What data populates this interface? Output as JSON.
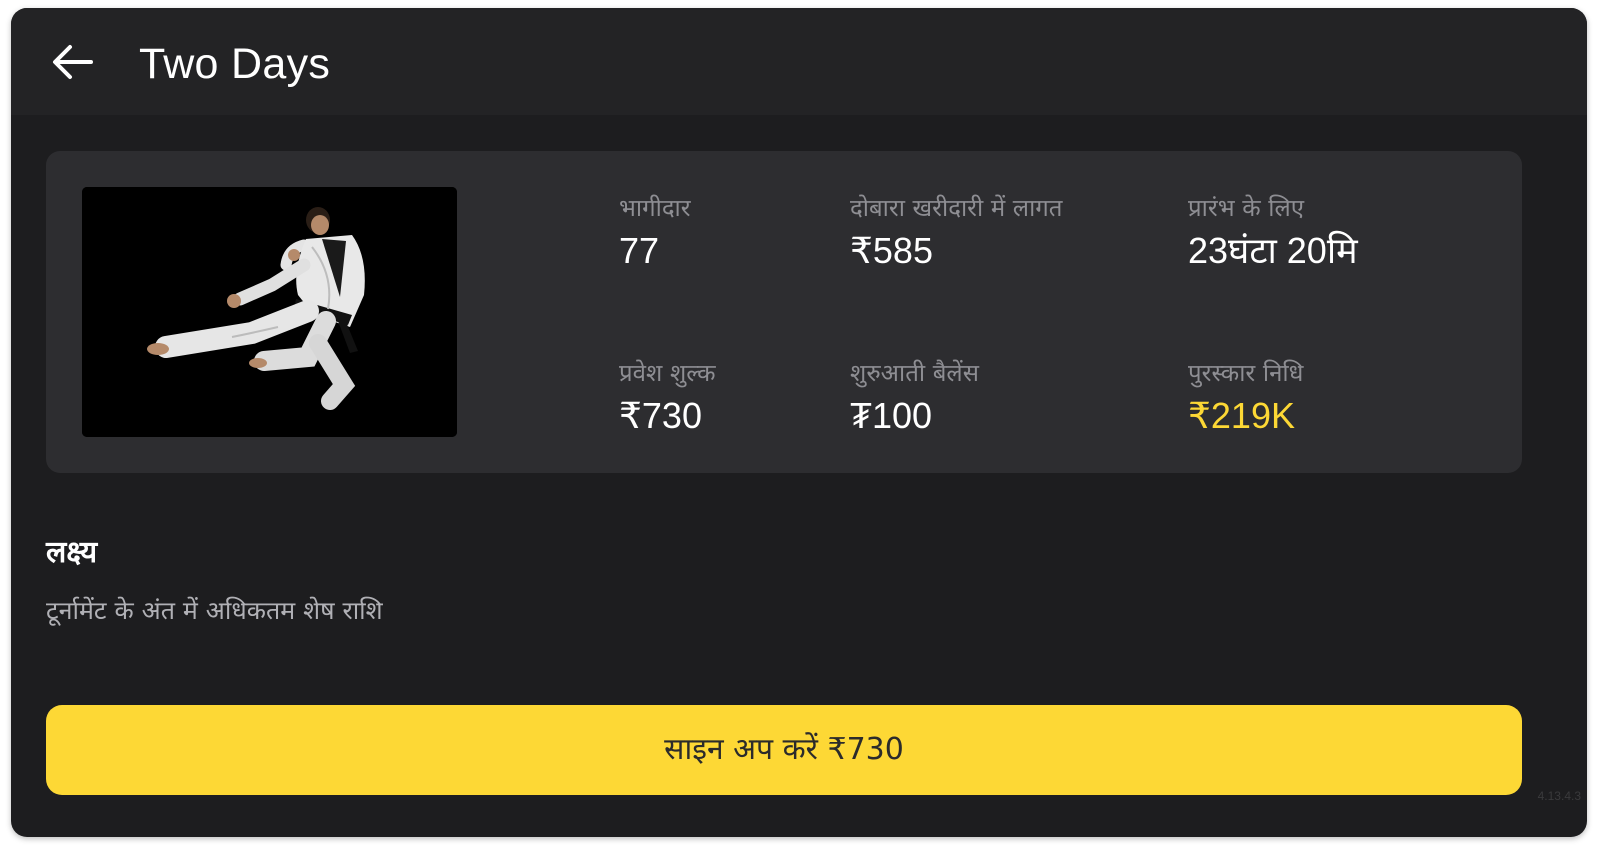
{
  "header": {
    "title": "Two Days",
    "back_icon": "arrow-left-icon"
  },
  "tournament": {
    "image": "taekwondo-athlete-flying-kick",
    "stats": {
      "participants": {
        "label": "भागीदार",
        "value": "77"
      },
      "rebuy_cost": {
        "label": "दोबारा खरीदारी में लागत",
        "value": "₹585"
      },
      "starts_in": {
        "label": "प्रारंभ के लिए",
        "value": "23घंटा 20मि"
      },
      "entry_fee": {
        "label": "प्रवेश शुल्क",
        "value": "₹730"
      },
      "starting_balance": {
        "label": "शुरुआती बैलेंस",
        "value": "₮100"
      },
      "prize_pool": {
        "label": "पुरस्कार निधि",
        "value": "₹219K"
      }
    }
  },
  "goal": {
    "heading": "लक्ष्य",
    "text": "टूर्नामेंट के अंत में अधिकतम शेष राशि"
  },
  "signup_button": {
    "label": "साइन अप करें ₹730"
  },
  "version": "4.13.4.3",
  "colors": {
    "background": "#1d1d1f",
    "header": "#232325",
    "card": "#2d2d30",
    "accent": "#fdd835",
    "label": "#8e8e93"
  }
}
